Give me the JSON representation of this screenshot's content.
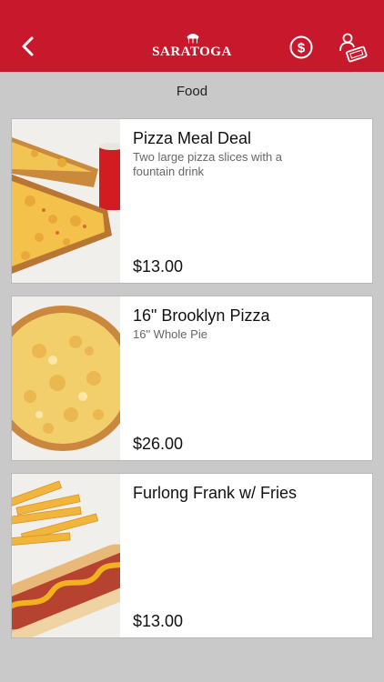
{
  "header": {
    "back_icon": "chevron-left-icon",
    "logo_text": "SARATOGA",
    "wallet_icon": "dollar-circle-icon",
    "ticket_icon": "ticket-icon",
    "background_color": "#c8182b"
  },
  "section": {
    "title": "Food"
  },
  "items": [
    {
      "name": "Pizza Meal Deal",
      "description": "Two large pizza slices with a fountain drink",
      "price": "$13.00",
      "image": "pizza-slices-with-drink"
    },
    {
      "name": "16\" Brooklyn Pizza",
      "description": "16\" Whole Pie",
      "price": "$26.00",
      "image": "whole-cheese-pizza"
    },
    {
      "name": "Furlong Frank w/ Fries",
      "description": "",
      "price": "$13.00",
      "image": "hot-dog-with-fries"
    }
  ]
}
